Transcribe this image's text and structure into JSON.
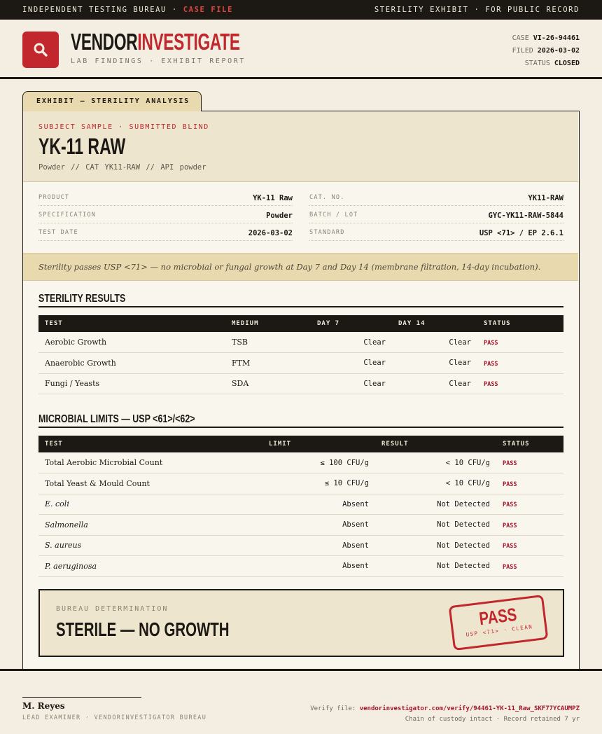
{
  "topbar": {
    "left_prefix": "INDEPENDENT TESTING BUREAU · ",
    "left_highlight": "CASE FILE",
    "right": "STERILITY EXHIBIT · FOR PUBLIC RECORD"
  },
  "header": {
    "brand_part1": "VENDOR",
    "brand_part2": "INVESTIGATE",
    "subtitle": "LAB FINDINGS · EXHIBIT REPORT",
    "case_label": "CASE",
    "case_value": "VI-26-94461",
    "filed_label": "FILED",
    "filed_value": "2026-03-02",
    "status_label": "STATUS",
    "status_value": "CLOSED",
    "logo_icon": "magnifier-icon",
    "accent_color": "#c1272d"
  },
  "exhibit": {
    "tab_label": "EXHIBIT — STERILITY ANALYSIS",
    "kicker": "SUBJECT SAMPLE · SUBMITTED BLIND",
    "title": "YK-11 RAW",
    "meta": "Powder  //  CAT YK11-RAW  //  API powder"
  },
  "specs": [
    {
      "key": "PRODUCT",
      "value": "YK-11 Raw"
    },
    {
      "key": "CAT. NO.",
      "value": "YK11-RAW"
    },
    {
      "key": "SPECIFICATION",
      "value": "Powder"
    },
    {
      "key": "BATCH / LOT",
      "value": "GYC-YK11-RAW-5844"
    },
    {
      "key": "TEST DATE",
      "value": "2026-03-02"
    },
    {
      "key": "STANDARD",
      "value": "USP <71> / EP 2.6.1"
    }
  ],
  "summary": "Sterility passes USP <71> — no microbial or fungal growth at Day 7 and Day 14 (membrane filtration, 14-day incubation).",
  "sterility": {
    "title": "STERILITY RESULTS",
    "headers": [
      "TEST",
      "MEDIUM",
      "DAY 7",
      "DAY 14",
      "STATUS"
    ],
    "rows": [
      {
        "test": "Aerobic Growth",
        "medium": "TSB",
        "day7": "Clear",
        "day14": "Clear",
        "status": "PASS"
      },
      {
        "test": "Anaerobic Growth",
        "medium": "FTM",
        "day7": "Clear",
        "day14": "Clear",
        "status": "PASS"
      },
      {
        "test": "Fungi / Yeasts",
        "medium": "SDA",
        "day7": "Clear",
        "day14": "Clear",
        "status": "PASS"
      }
    ]
  },
  "microbial": {
    "title": "MICROBIAL LIMITS — USP <61>/<62>",
    "headers": [
      "TEST",
      "LIMIT",
      "RESULT",
      "STATUS"
    ],
    "rows": [
      {
        "test": "Total Aerobic Microbial Count",
        "italic": false,
        "limit": "≤ 100 CFU/g",
        "result": "< 10 CFU/g",
        "status": "PASS"
      },
      {
        "test": "Total Yeast & Mould Count",
        "italic": false,
        "limit": "≤ 10 CFU/g",
        "result": "< 10 CFU/g",
        "status": "PASS"
      },
      {
        "test": "E. coli",
        "italic": true,
        "limit": "Absent",
        "result": "Not Detected",
        "status": "PASS"
      },
      {
        "test": "Salmonella",
        "italic": true,
        "limit": "Absent",
        "result": "Not Detected",
        "status": "PASS"
      },
      {
        "test": "S. aureus",
        "italic": true,
        "limit": "Absent",
        "result": "Not Detected",
        "status": "PASS"
      },
      {
        "test": "P. aeruginosa",
        "italic": true,
        "limit": "Absent",
        "result": "Not Detected",
        "status": "PASS"
      }
    ]
  },
  "determination": {
    "kicker": "BUREAU DETERMINATION",
    "verdict": "STERILE — NO GROWTH",
    "stamp_main": "PASS",
    "stamp_sub": "USP <71> · CLEAN"
  },
  "footer": {
    "signer": "M. Reyes",
    "role": "LEAD EXAMINER · VENDORINVESTIGATOR BUREAU",
    "verify_label": "Verify file:",
    "verify_url": "vendorinvestigator.com/verify/94461-YK-11_Raw_SKF77YCAUMPZ",
    "custody": "Chain of custody intact · Record retained 7 yr"
  }
}
